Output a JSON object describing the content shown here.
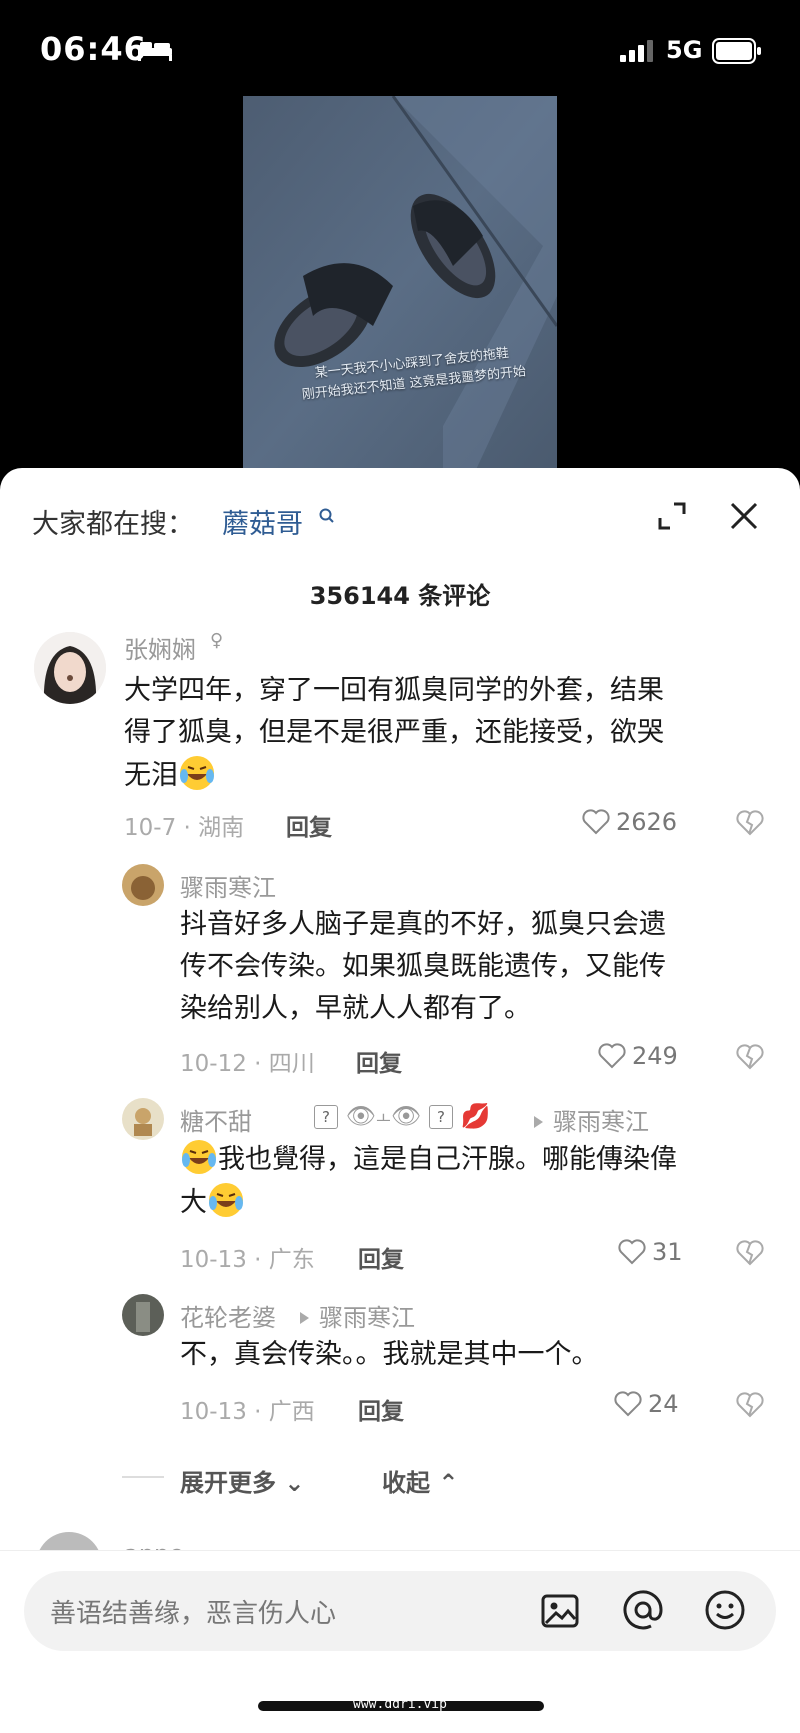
{
  "status": {
    "time": "06:46",
    "network": "5G"
  },
  "video": {
    "caption_line1": "某一天我不小心踩到了舍友的拖鞋",
    "caption_line2": "刚开始我还不知道 这竟是我噩梦的开始"
  },
  "search": {
    "prefix": "大家都在搜：",
    "term": "蘑菇哥"
  },
  "comment_count": "356144 条评论",
  "comments": [
    {
      "username": "张娴娴",
      "text_line1": "大学四年，穿了一回有狐臭同学的外套，结果",
      "text_line2": "得了狐臭，但是不是很严重，还能接受，欲哭",
      "text_line3": "无泪",
      "date_location": "10-7 · 湖南",
      "reply": "回复",
      "likes": "2626"
    },
    {
      "username": "骤雨寒江",
      "text_line1": "抖音好多人脑子是真的不好，狐臭只会遗",
      "text_line2": "传不会传染。如果狐臭既能遗传，又能传",
      "text_line3": "染给别人，早就人人都有了。",
      "date_location": "10-12 · 四川",
      "reply": "回复",
      "likes": "249"
    },
    {
      "username": "糖不甜",
      "reply_to": "骤雨寒江",
      "text_line1": "我也覺得，這是自己汗腺。哪能傳染偉",
      "text_line2": "大",
      "date_location": "10-13 · 广东",
      "reply": "回复",
      "likes": "31"
    },
    {
      "username": "花轮老婆",
      "reply_to": "骤雨寒江",
      "text_line1": "不，真会传染。。我就是其中一个。",
      "date_location": "10-13 · 广西",
      "reply": "回复",
      "likes": "24"
    }
  ],
  "expand_more": "展开更多",
  "collapse": "收起",
  "next_username": "anne",
  "input": {
    "placeholder": "善语结善缘，恶言伤人心"
  },
  "watermark": "www.ddri.vip"
}
